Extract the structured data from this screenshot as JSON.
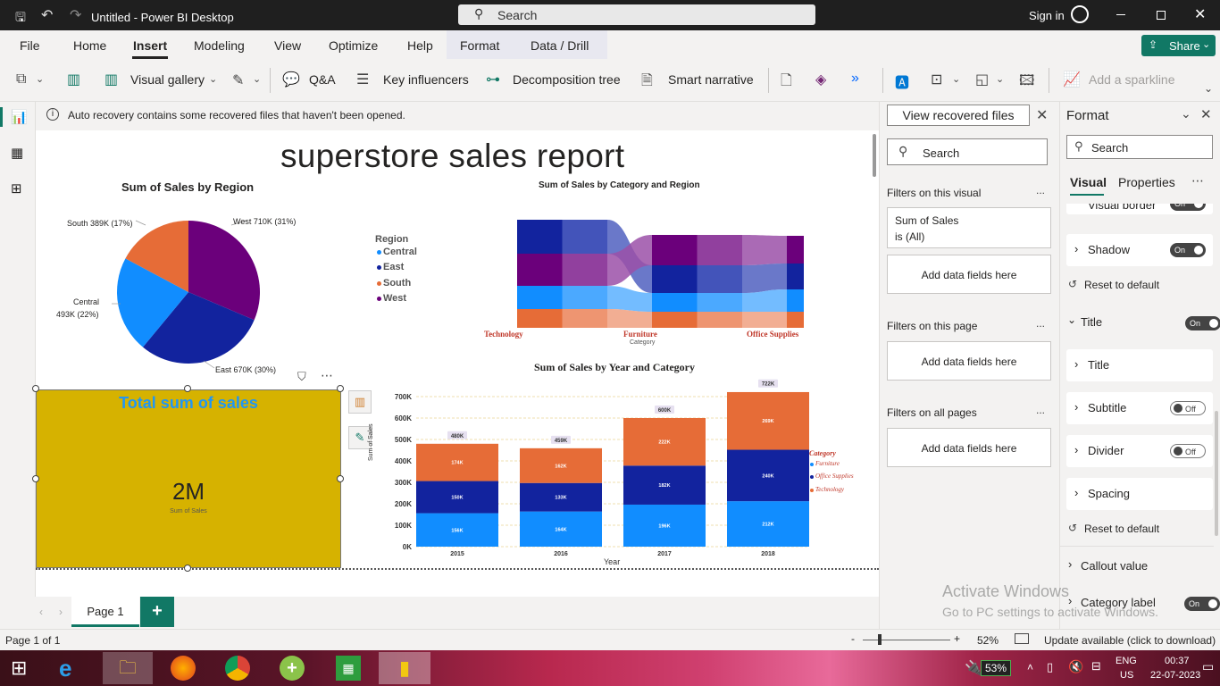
{
  "window": {
    "title": "Untitled - Power BI Desktop",
    "search_placeholder": "Search",
    "signin": "Sign in"
  },
  "menu": [
    "File",
    "Home",
    "Insert",
    "Modeling",
    "View",
    "Optimize",
    "Help",
    "Format",
    "Data / Drill"
  ],
  "share_label": "Share",
  "ribbon": {
    "visual_gallery": "Visual gallery",
    "qa": "Q&A",
    "key_influencers": "Key influencers",
    "decomposition_tree": "Decomposition tree",
    "smart_narrative": "Smart narrative",
    "add_sparkline": "Add a sparkline"
  },
  "notification": {
    "message": "Auto recovery contains some recovered files that haven't been opened.",
    "button": "View recovered files"
  },
  "report": {
    "title": "superstore sales report",
    "pie": {
      "title": "Sum of Sales by Region",
      "labels": {
        "west": "West 710K (31%)",
        "south": "South 389K (17%)",
        "central_1": "Central",
        "central_2": "493K (22%)",
        "east": "East 670K (30%)"
      }
    },
    "ribbon_chart": {
      "title": "Sum of Sales by Category and Region",
      "legend_title": "Region",
      "legend": [
        "Central",
        "East",
        "South",
        "West"
      ],
      "categories": [
        "Technology",
        "Furniture",
        "Office Supplies"
      ],
      "xlabel": "Category"
    },
    "card": {
      "title": "Total sum of sales",
      "value": "2M",
      "label": "Sum of Sales"
    },
    "bar_chart": {
      "title": "Sum of Sales by Year and Category",
      "xlabel": "Year",
      "ylabel": "Sum of Sales",
      "yticks": [
        "700K",
        "600K",
        "500K",
        "400K",
        "300K",
        "200K",
        "100K",
        "0K"
      ],
      "legend_title": "Category",
      "legend": [
        "Furniture",
        "Office Supplies",
        "Technology"
      ]
    }
  },
  "chart_data": [
    {
      "type": "pie",
      "title": "Sum of Sales by Region",
      "categories": [
        "West",
        "East",
        "Central",
        "South"
      ],
      "values": [
        710,
        670,
        493,
        389
      ],
      "percent": [
        31,
        30,
        22,
        17
      ],
      "colors": [
        "#6b007b",
        "#12239e",
        "#118dff",
        "#e66c37"
      ]
    },
    {
      "type": "area",
      "title": "Sum of Sales by Category and Region",
      "categories": [
        "Technology",
        "Furniture",
        "Office Supplies"
      ],
      "xlabel": "Category",
      "legend_title": "Region",
      "series": [
        {
          "name": "Central",
          "color": "#118dff"
        },
        {
          "name": "East",
          "color": "#12239e"
        },
        {
          "name": "South",
          "color": "#e66c37"
        },
        {
          "name": "West",
          "color": "#6b007b"
        }
      ]
    },
    {
      "type": "bar",
      "title": "Sum of Sales by Year and Category",
      "categories": [
        "2015",
        "2016",
        "2017",
        "2018"
      ],
      "xlabel": "Year",
      "ylabel": "Sum of Sales",
      "ylim": [
        0,
        700
      ],
      "stacked": true,
      "totals": [
        "480K",
        "459K",
        "600K",
        "722K"
      ],
      "total_values": [
        480,
        459,
        600,
        722
      ],
      "series": [
        {
          "name": "Furniture",
          "values": [
            156,
            164,
            196,
            212
          ],
          "labels": [
            "156K",
            "164K",
            "196K",
            "212K"
          ],
          "color": "#118dff"
        },
        {
          "name": "Office Supplies",
          "values": [
            150,
            133,
            182,
            240
          ],
          "labels": [
            "150K",
            "133K",
            "182K",
            "240K"
          ],
          "color": "#12239e"
        },
        {
          "name": "Technology",
          "values": [
            174,
            162,
            222,
            269
          ],
          "labels": [
            "174K",
            "162K",
            "222K",
            "269K"
          ],
          "color": "#e66c37"
        }
      ],
      "legend_title": "Category",
      "grid": true,
      "legend_placement": "right"
    }
  ],
  "filters": {
    "search_placeholder": "Search",
    "on_visual": "Filters on this visual",
    "sum_sales_1": "Sum of Sales",
    "sum_sales_2": "is (All)",
    "add_fields": "Add data fields here",
    "on_page": "Filters on this page",
    "on_all": "Filters on all pages",
    "more": "..."
  },
  "format_pane": {
    "title": "Format",
    "search_placeholder": "Search",
    "tab_visual": "Visual",
    "tab_properties": "Properties",
    "visual_border": "Visual border",
    "shadow": "Shadow",
    "reset": "Reset to default",
    "title_section": "Title",
    "title_item": "Title",
    "subtitle": "Subtitle",
    "divider": "Divider",
    "spacing": "Spacing",
    "callout": "Callout value",
    "category_label": "Category label",
    "on": "On",
    "off": "Off"
  },
  "watermark": {
    "line1": "Activate Windows",
    "line2": "Go to PC settings to activate Windows."
  },
  "page_tab": "Page 1",
  "status": {
    "page": "Page 1 of 1",
    "zoom": "52%",
    "update": "Update available (click to download)"
  },
  "taskbar": {
    "battery": "53%",
    "lang1": "ENG",
    "lang2": "US",
    "time": "00:37",
    "date": "22-07-2023"
  }
}
